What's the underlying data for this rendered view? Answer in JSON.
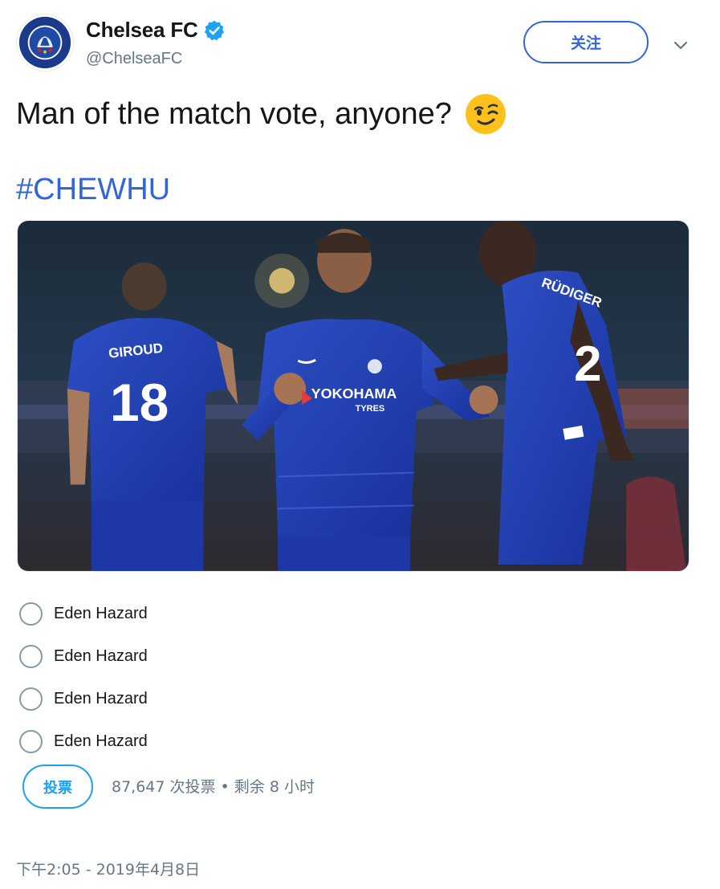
{
  "account": {
    "display_name": "Chelsea FC",
    "handle": "@ChelseaFC",
    "verified": true,
    "follow_label": "关注"
  },
  "tweet": {
    "text": "Man of the match vote, anyone?",
    "emoji": "winking-face",
    "hashtag": "#CHEWHU"
  },
  "media": {
    "jersey_left_name": "GIROUD",
    "jersey_left_number": "18",
    "jersey_center_sponsor": "YOKOHAMA",
    "jersey_center_sponsor_sub": "TYRES",
    "jersey_right_name": "RÜDIGER",
    "jersey_right_number": "2"
  },
  "poll": {
    "options": [
      {
        "label": "Eden Hazard"
      },
      {
        "label": "Eden Hazard"
      },
      {
        "label": "Eden Hazard"
      },
      {
        "label": "Eden Hazard"
      }
    ],
    "vote_label": "投票",
    "meta": "87,647 次投票 • 剩余 8 小时"
  },
  "timestamp": "下午2:05 - 2019年4月8日",
  "colors": {
    "link": "#3165d8",
    "poll_accent": "#1da1f2",
    "secondary_text": "#657786",
    "chelsea_blue": "#034694"
  }
}
